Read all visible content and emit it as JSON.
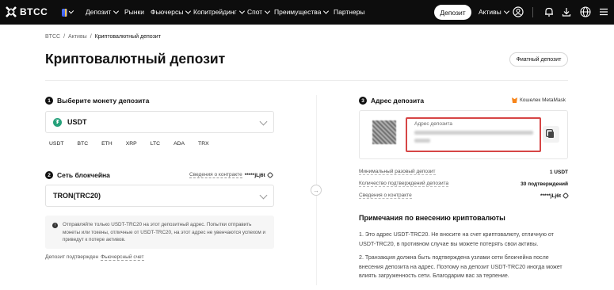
{
  "nav": {
    "logo": "BTCC",
    "items": [
      {
        "label": "Депозит",
        "dropdown": true
      },
      {
        "label": "Рынки",
        "dropdown": false
      },
      {
        "label": "Фьючерсы",
        "dropdown": true
      },
      {
        "label": "Копитрейдинг",
        "dropdown": true
      },
      {
        "label": "Спот",
        "dropdown": true
      },
      {
        "label": "Преимущества",
        "dropdown": true
      },
      {
        "label": "Партнеры",
        "dropdown": false
      }
    ],
    "deposit_button": "Депозит",
    "assets_label": "Активы",
    "icons": [
      "user-icon",
      "bell-icon",
      "download-icon",
      "globe-icon",
      "menu-icon"
    ]
  },
  "breadcrumb": [
    "BTCC",
    "/",
    "Активы",
    "/",
    "Криптовалютный депозит"
  ],
  "page_title": "Криптовалютный депозит",
  "fiat_button": "Фиатный депозит",
  "step1": {
    "number": "1",
    "title": "Выберите монету депозита",
    "selected": "USDT",
    "coins": [
      "USDT",
      "BTC",
      "ETH",
      "XRP",
      "LTC",
      "ADA",
      "TRX"
    ]
  },
  "step2": {
    "number": "2",
    "title": "Сеть блокчейна",
    "contract_label": "Сведения о контракте",
    "contract_value": "*****jLj6t",
    "selected": "TRON(TRC20)"
  },
  "notice": "Отправляйте только USDT-TRC20 на этот депозитный адрес. Попытки отправить монеты или токены, отличные от USDT-TRC20, на этот адрес не увенчаются успехом и приведут к потере активов.",
  "confirm": {
    "prefix": "Депозит подтвержден",
    "account": "Фьючерсный счет"
  },
  "step3": {
    "number": "3",
    "title": "Адрес депозита",
    "wallet": "Кошелек MetaMask",
    "address_label": "Адрес депозита"
  },
  "details": [
    {
      "label": "Минимальный разовый депозит",
      "value": "1 USDT"
    },
    {
      "label": "Количество подтверждений депозита",
      "value": "30 подтверждений"
    },
    {
      "label": "Сведения о контракте",
      "value": "*****jLj6t"
    }
  ],
  "notes": {
    "title": "Примечания по внесению криптовалюты",
    "p1": "1. Это адрес USDT-TRC20. Не вносите на счет криптовалюту, отличную от USDT-TRC20, в противном случае вы можете потерять свои активы.",
    "p2": "2. Транзакция должна быть подтверждена узлами сети блокчейна после внесения депозита на адрес. Поэтому на депозит USDT-TRC20 иногда может влиять загруженность сети. Благодарим вас за терпение."
  },
  "colors": {
    "nav_bg": "#0d0d0d",
    "highlight": "#d64545",
    "tether": "#26a17b"
  }
}
